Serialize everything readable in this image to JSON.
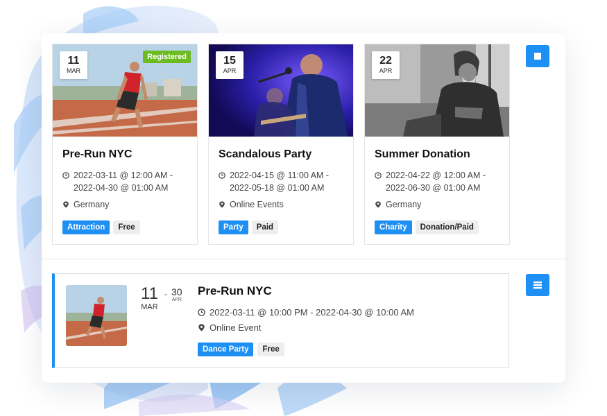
{
  "colors": {
    "accent": "#1e8ff3",
    "registered": "#6cbb21",
    "tag_gray": "#eeeeee"
  },
  "grid_cards": [
    {
      "day": "11",
      "month": "MAR",
      "badge": "Registered",
      "title": "Pre-Run NYC",
      "time_line1": "2022-03-11 @ 12:00 AM -",
      "time_line2": "2022-04-30 @ 01:00 AM",
      "location": "Germany",
      "tags": [
        "Attraction",
        "Free"
      ]
    },
    {
      "day": "15",
      "month": "APR",
      "title": "Scandalous Party",
      "time_line1": "2022-04-15 @ 11:00 AM -",
      "time_line2": "2022-05-18 @ 01:00 AM",
      "location": "Online Events",
      "tags": [
        "Party",
        "Paid"
      ]
    },
    {
      "day": "22",
      "month": "APR",
      "title": "Summer Donation",
      "time_line1": "2022-04-22 @ 12:00 AM -",
      "time_line2": "2022-06-30 @ 01:00 AM",
      "location": "Germany",
      "tags": [
        "Charity",
        "Donation/Paid"
      ]
    }
  ],
  "list_item": {
    "start_day": "11",
    "start_month": "MAR",
    "dash": "-",
    "end_day": "30",
    "end_month": "APR",
    "title": "Pre-Run NYC",
    "time": "2022-03-11 @ 10:00 PM - 2022-04-30 @ 10:00 AM",
    "location": "Online Event",
    "tags": [
      "Dance Party",
      "Free"
    ]
  },
  "icons": {
    "grid_view": "grid-view-icon",
    "list_view": "list-view-icon",
    "clock": "clock-icon",
    "pin": "map-pin-icon"
  }
}
